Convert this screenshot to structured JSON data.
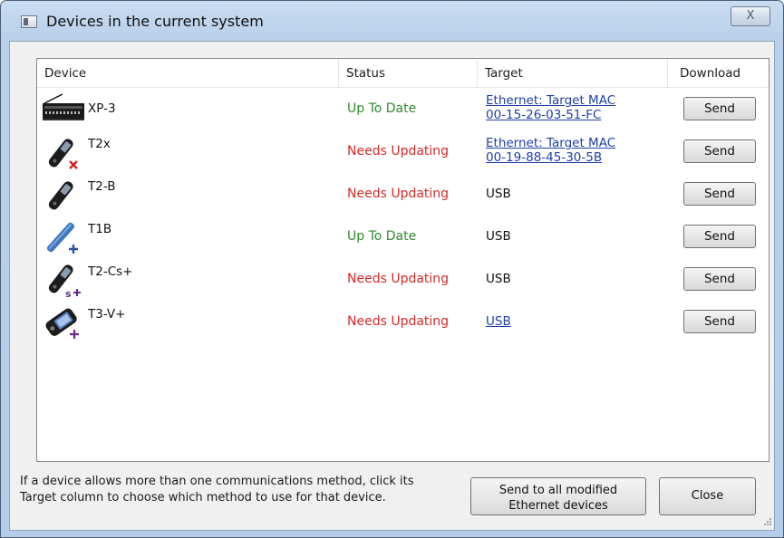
{
  "window": {
    "title": "Devices in the current system",
    "close_glyph": "X"
  },
  "columns": {
    "device": "Device",
    "status": "Status",
    "target": "Target",
    "download": "Download"
  },
  "devices": [
    {
      "name": "XP-3",
      "status": "Up To Date",
      "target_line1": "Ethernet: Target MAC",
      "target_line2": "00-15-26-03-51-FC",
      "button": "Send",
      "icon": "xp3-panel-icon"
    },
    {
      "name": "T2x",
      "status": "Needs Updating",
      "target_line1": "Ethernet: Target MAC",
      "target_line2": "00-19-88-45-30-5B",
      "button": "Send",
      "icon": "remote-x-icon"
    },
    {
      "name": "T2-B",
      "status": "Needs Updating",
      "target_line1": "USB",
      "button": "Send",
      "icon": "remote-icon"
    },
    {
      "name": "T1B",
      "status": "Up To Date",
      "target_line1": "USB",
      "button": "Send",
      "icon": "remote-blue-plus-icon"
    },
    {
      "name": "T2-Cs+",
      "status": "Needs Updating",
      "target_line1": "USB",
      "button": "Send",
      "icon": "remote-s-plus-icon"
    },
    {
      "name": "T3-V+",
      "status": "Needs Updating",
      "target_line1": "USB",
      "button": "Send",
      "icon": "remote-screen-plus-icon"
    }
  ],
  "footer": {
    "hint_line1": "If a device allows more than one communications method, click its",
    "hint_line2": "Target column to choose which method to use for that device.",
    "send_all_line1": "Send to all modified",
    "send_all_line2": "Ethernet devices",
    "close_label": "Close"
  },
  "colors": {
    "up_to_date": "#2e8b2e",
    "needs_updating": "#d42a2a",
    "link": "#1d3fa6"
  }
}
